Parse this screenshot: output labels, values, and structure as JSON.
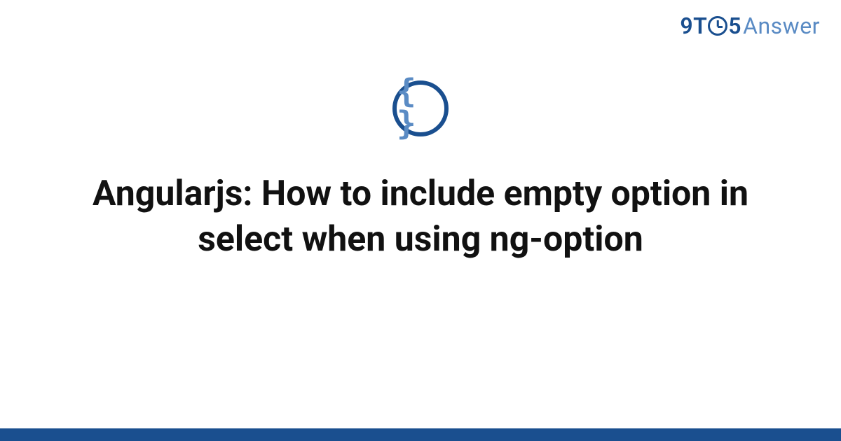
{
  "logo": {
    "part_nine": "9",
    "part_t": "T",
    "part_five": "5",
    "part_answer": "Answer"
  },
  "icon": {
    "glyph": "{ }"
  },
  "title": "Angularjs: How to include empty option in select when using ng-option",
  "colors": {
    "primary": "#1a4f8f",
    "secondary": "#5a8bc4",
    "text": "#111111",
    "background": "#ffffff"
  }
}
